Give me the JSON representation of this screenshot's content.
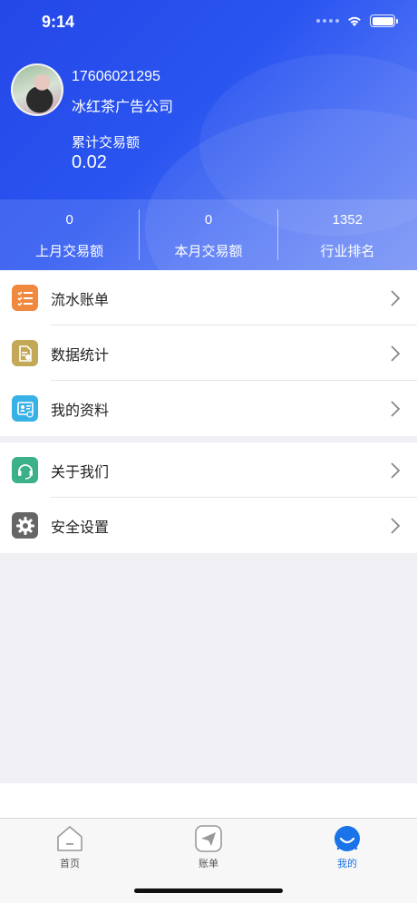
{
  "status_bar": {
    "time": "9:14"
  },
  "profile": {
    "phone": "17606021295",
    "company": "冰红茶广告公司",
    "total_label": "累计交易额",
    "total_value": "0.02"
  },
  "stats": [
    {
      "value": "0",
      "label": "上月交易额"
    },
    {
      "value": "0",
      "label": "本月交易额"
    },
    {
      "value": "1352",
      "label": "行业排名"
    }
  ],
  "menu_group1": [
    {
      "label": "流水账单",
      "icon": "list-icon",
      "color": "#f0883e"
    },
    {
      "label": "数据统计",
      "icon": "document-chart-icon",
      "color": "#c3a857"
    },
    {
      "label": "我的资料",
      "icon": "profile-card-icon",
      "color": "#38b1e6"
    }
  ],
  "menu_group2": [
    {
      "label": "关于我们",
      "icon": "headset-icon",
      "color": "#3bb089"
    },
    {
      "label": "安全设置",
      "icon": "gear-icon",
      "color": "#666666"
    }
  ],
  "tabs": [
    {
      "label": "首页",
      "icon": "home-icon"
    },
    {
      "label": "账单",
      "icon": "paper-plane-icon"
    },
    {
      "label": "我的",
      "icon": "smile-icon",
      "active": true
    }
  ],
  "colors": {
    "header_blue": "#2447e8",
    "active_tab": "#1a73e8"
  }
}
